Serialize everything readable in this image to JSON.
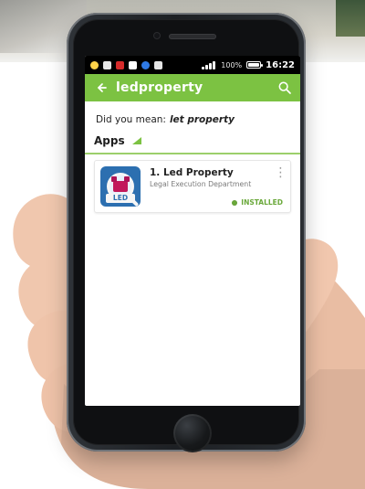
{
  "status_bar": {
    "time": "16:22",
    "battery_percent_text": "100%",
    "signal_level": 0.9,
    "battery_level": 1.0,
    "left_icons": [
      {
        "name": "notification-icon",
        "color": "#ffd24a"
      },
      {
        "name": "image-icon",
        "color": "#e6e6e6"
      },
      {
        "name": "message-icon",
        "color": "#d62b2b"
      },
      {
        "name": "alert-icon",
        "color": "#ffffff"
      },
      {
        "name": "app-icon",
        "color": "#2f7ae5"
      },
      {
        "name": "sim-icon",
        "color": "#e6e6e6"
      }
    ]
  },
  "app_bar": {
    "back_icon": "back-arrow-icon",
    "query": "ledproperty",
    "search_icon": "search-icon",
    "accent": "#7cc242"
  },
  "did_you_mean": {
    "label": "Did you mean:",
    "suggestion": "let property"
  },
  "section": {
    "label": "Apps"
  },
  "results": [
    {
      "title": "1. Led Property",
      "subtitle": "Legal Execution Department",
      "installed_label": "INSTALLED",
      "icon_text": "LED",
      "more_icon": "more-vert-icon"
    }
  ]
}
